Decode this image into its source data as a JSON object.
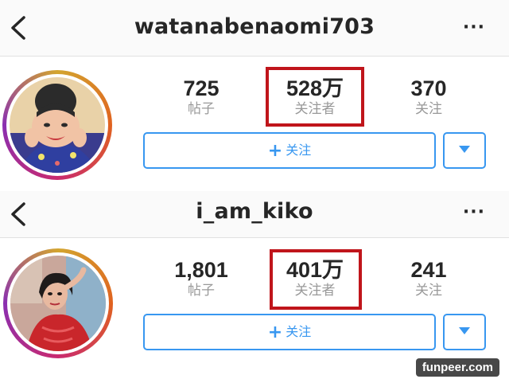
{
  "profiles": [
    {
      "username": "watanabenaomi703",
      "more_label": "···",
      "stats": [
        {
          "value": "725",
          "label": "帖子"
        },
        {
          "value": "528万",
          "label": "关注者"
        },
        {
          "value": "370",
          "label": "关注"
        }
      ],
      "follow_label": "关注",
      "plus": "+"
    },
    {
      "username": "i_am_kiko",
      "more_label": "···",
      "stats": [
        {
          "value": "1,801",
          "label": "帖子"
        },
        {
          "value": "401万",
          "label": "关注者"
        },
        {
          "value": "241",
          "label": "关注"
        }
      ],
      "follow_label": "关注",
      "plus": "+"
    }
  ],
  "watermark": "funpeer.com",
  "colors": {
    "accent": "#3897f0",
    "highlight": "#c0151b",
    "text": "#262626",
    "muted": "#999999"
  }
}
